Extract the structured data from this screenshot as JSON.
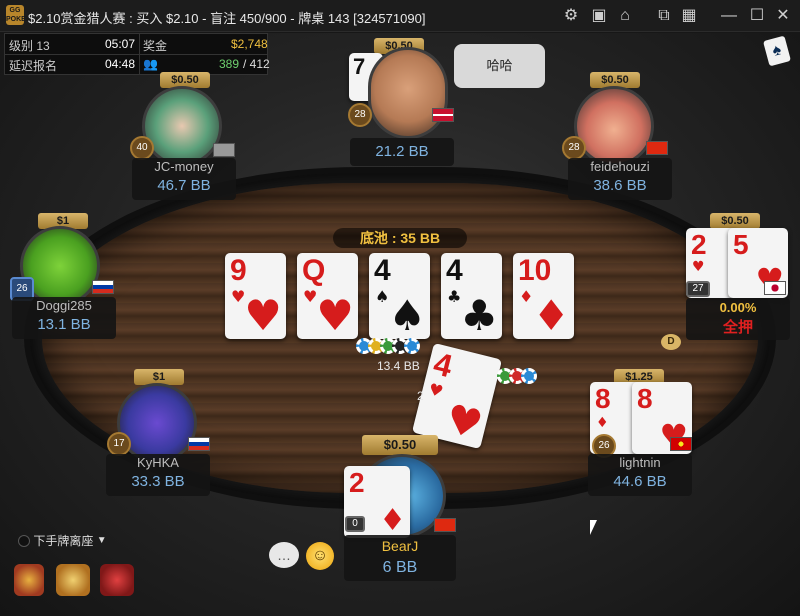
{
  "window": {
    "logo_text": "GG\nPOKER",
    "title": "$2.10赏金猎人赛 : 买入 $2.10 - 盲注 450/900 - 牌桌 143 [324571090]",
    "icons": [
      "gear-icon",
      "layout-icon",
      "home-icon",
      "tile-icon",
      "grid-icon",
      "minimize-icon",
      "maximize-icon",
      "close-icon"
    ]
  },
  "info": {
    "level_label": "级别 13",
    "level_time": "05:07",
    "prize_label": "奖金",
    "prize_value": "$2,748",
    "late_reg_label": "延迟报名",
    "late_reg_time": "04:48",
    "players_left": "389",
    "players_total": "/ 412"
  },
  "pot": {
    "text": "底池 : 35 BB"
  },
  "board": [
    {
      "rank": "9",
      "suit": "♥",
      "color": "red"
    },
    {
      "rank": "Q",
      "suit": "♥",
      "color": "red"
    },
    {
      "rank": "4",
      "suit": "♠",
      "color": "black"
    },
    {
      "rank": "4",
      "suit": "♣",
      "color": "black"
    },
    {
      "rank": "10",
      "suit": "♦",
      "color": "red"
    }
  ],
  "players": {
    "top": {
      "name": "",
      "stack": "21.2 BB",
      "bounty": "$0.50",
      "level": "28",
      "chat": "哈哈",
      "card_rank": "7"
    },
    "jcmoney": {
      "name": "JC-money",
      "stack": "46.7 BB",
      "bounty": "$0.50",
      "level": "40"
    },
    "feidehouzi": {
      "name": "feidehouzi",
      "stack": "38.6 BB",
      "bounty": "$0.50",
      "level": "28"
    },
    "doggi": {
      "name": "Doggi285",
      "stack": "13.1 BB",
      "bounty": "$1",
      "level": "26"
    },
    "right": {
      "name": "",
      "bounty": "$0.50",
      "level": "27",
      "equity": "0.00%",
      "action": "全押",
      "cards": [
        {
          "rank": "2",
          "suit": "♥"
        },
        {
          "rank": "5",
          "suit": "♥"
        }
      ]
    },
    "kyhka": {
      "name": "KyHKA",
      "stack": "33.3 BB",
      "bounty": "$1",
      "level": "17"
    },
    "lightnin": {
      "name": "lightnin",
      "stack": "44.6 BB",
      "bounty": "$1.25",
      "level": "26",
      "cards": [
        {
          "rank": "8",
          "suit": "♦"
        },
        {
          "rank": "8",
          "suit": "♥"
        }
      ]
    },
    "hero": {
      "name": "BearJ",
      "stack": "6 BB",
      "bounty": "$0.50",
      "level": "0",
      "cards": [
        {
          "rank": "2",
          "suit": "♦"
        }
      ]
    }
  },
  "bets": {
    "center_amount": "13.4 BB",
    "flying_card": {
      "rank": "4",
      "suit": "♥"
    },
    "flying_prefix": "2"
  },
  "controls": {
    "sitout_label": "下手牌离座",
    "dealer_label": "D"
  },
  "colors": {
    "accent_gold": "#f0c040",
    "stack_blue": "#7fb3e0",
    "green_count": "#6fd16f",
    "allin_red": "#e02020"
  }
}
